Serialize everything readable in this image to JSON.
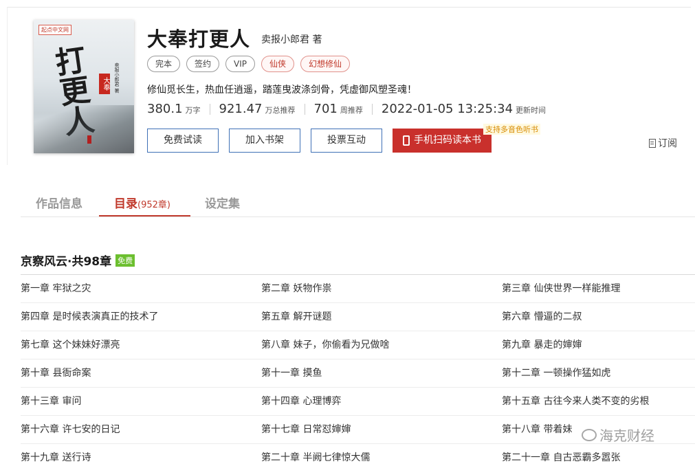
{
  "book": {
    "title": "大奉打更人",
    "author": "卖报小郎君 著",
    "tags": [
      {
        "label": "完本",
        "style": "gray"
      },
      {
        "label": "签约",
        "style": "gray"
      },
      {
        "label": "VIP",
        "style": "gray"
      },
      {
        "label": "仙侠",
        "style": "red"
      },
      {
        "label": "幻想修仙",
        "style": "red"
      }
    ],
    "intro": "修仙觅长生，热血任逍遥，踏莲曳波涤剑骨，凭虚御风塑圣魂！",
    "stats": [
      {
        "num": "380.1",
        "unit": "万字"
      },
      {
        "num": "921.47",
        "unit": "万总推荐"
      },
      {
        "num": "701",
        "unit": "周推荐"
      },
      {
        "num": "2022-01-05 13:25:34",
        "unit": "更新时间"
      }
    ]
  },
  "cover": {
    "publisher": "起点中文网",
    "title_art": "打更人",
    "seal": "大奉",
    "author_vertical": "卖报小郎君 著"
  },
  "actions": {
    "free_read": "免费试读",
    "add_shelf": "加入书架",
    "vote": "投票互动",
    "scan_read": "手机扫码读本书",
    "promo": "支持多音色听书",
    "subscribe": "订阅"
  },
  "tabs": {
    "info": "作品信息",
    "catalog": "目录",
    "catalog_count": "(952章)",
    "settings": "设定集"
  },
  "volume": {
    "title": "京察风云·共98章",
    "badge": "免费"
  },
  "chapters": [
    [
      "第一章 牢狱之灾",
      "第二章 妖物作祟",
      "第三章 仙侠世界一样能推理"
    ],
    [
      "第四章 是时候表演真正的技术了",
      "第五章 解开谜题",
      "第六章 懵逼的二叔"
    ],
    [
      "第七章 这个妹妹好漂亮",
      "第八章 妹子，你偷看为兄做啥",
      "第九章 暴走的婶婶"
    ],
    [
      "第十章 县衙命案",
      "第十一章 摸鱼",
      "第十二章 一顿操作猛如虎"
    ],
    [
      "第十三章 审问",
      "第十四章 心理博弈",
      "第十五章 古往今来人类不变的劣根"
    ],
    [
      "第十六章 许七安的日记",
      "第十七章 日常怼婶婶",
      "第十八章 带着妹"
    ],
    [
      "第十九章 送行诗",
      "第二十章 半阙七律惊大儒",
      "第二十一章 自古恶霸多嚣张"
    ]
  ],
  "watermark": "海克财经"
}
